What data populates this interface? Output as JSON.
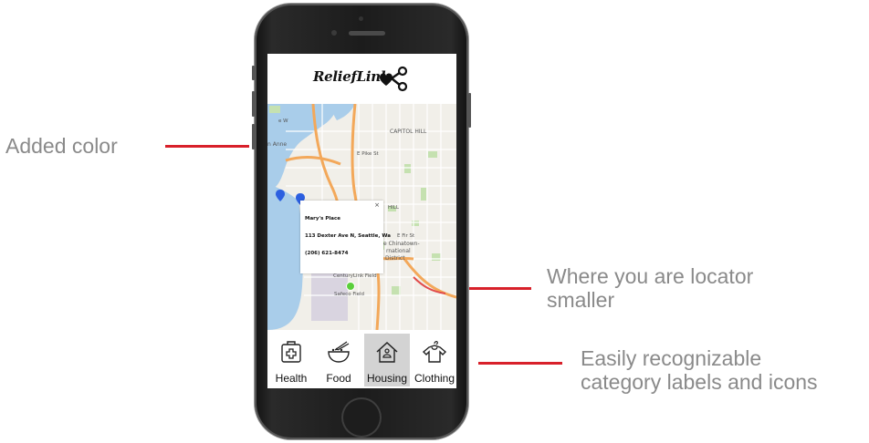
{
  "annotations": {
    "added_color": "Added color",
    "locator_line1": "Where you are locator",
    "locator_line2": "smaller",
    "labels_line1": "Easily recognizable",
    "labels_line2": "category labels and icons"
  },
  "app": {
    "logo_text": "ReliefLink",
    "logo_icon": "heart-share-icon"
  },
  "map": {
    "labels": {
      "capitol_hill": "CAPITOL HILL",
      "chinatown_1": "e Chinatown-",
      "chinatown_2": "rnational",
      "chinatown_3": "District",
      "centurylink": "CenturyLink Field",
      "safeco": "Safeco Field",
      "e_pike": "E Pike St",
      "e_fir": "E Fir St",
      "hill": "HILL",
      "north_anne": "n Anne",
      "ave_w": "e W"
    },
    "colors": {
      "water": "#a6cbe8",
      "land": "#f0eeea",
      "park": "#c8e3b4",
      "highway": "#f3a95a",
      "pin_blue": "#2c5fe0",
      "pin_green": "#5bcf3c"
    }
  },
  "popup": {
    "name": "Mary's Place",
    "address": "113 Dexter Ave N, Seattle, Wa",
    "phone": "(206) 621-8474",
    "close": "×"
  },
  "nav": [
    {
      "label": "Health",
      "icon": "health-icon",
      "active": false
    },
    {
      "label": "Food",
      "icon": "food-bowl-icon",
      "active": false
    },
    {
      "label": "Housing",
      "icon": "house-icon",
      "active": true
    },
    {
      "label": "Clothing",
      "icon": "shirt-icon",
      "active": false
    }
  ]
}
